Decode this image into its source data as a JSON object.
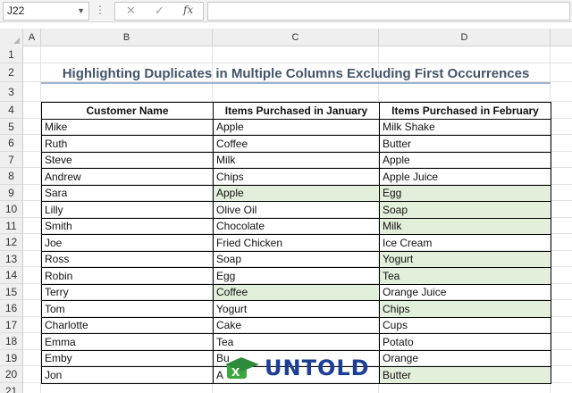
{
  "formula_bar": {
    "name_box": "J22",
    "cancel_icon": "✕",
    "enter_icon": "✓",
    "fx_label": "fx",
    "formula": ""
  },
  "columns": [
    "A",
    "B",
    "C",
    "D"
  ],
  "rows": [
    "1",
    "2",
    "3",
    "4",
    "5",
    "6",
    "7",
    "8",
    "9",
    "10",
    "11",
    "12",
    "13",
    "14",
    "15",
    "16",
    "17",
    "18",
    "19",
    "20",
    "21"
  ],
  "title": "Highlighting Duplicates in Multiple Columns Excluding First Occurrences",
  "table": {
    "headers": [
      "Customer Name",
      "Items Purchased in January",
      "Items Purchased in February"
    ],
    "rows": [
      {
        "name": "Mike",
        "jan": "Apple",
        "feb": "Milk Shake",
        "jan_hl": false,
        "feb_hl": false
      },
      {
        "name": "Ruth",
        "jan": "Coffee",
        "feb": "Butter",
        "jan_hl": false,
        "feb_hl": false
      },
      {
        "name": "Steve",
        "jan": "Milk",
        "feb": "Apple",
        "jan_hl": false,
        "feb_hl": false
      },
      {
        "name": "Andrew",
        "jan": "Chips",
        "feb": "Apple Juice",
        "jan_hl": false,
        "feb_hl": false
      },
      {
        "name": "Sara",
        "jan": "Apple",
        "feb": "Egg",
        "jan_hl": true,
        "feb_hl": true
      },
      {
        "name": " Lilly",
        "jan": "Olive Oil",
        "feb": "Soap",
        "jan_hl": false,
        "feb_hl": true
      },
      {
        "name": "Smith",
        "jan": "Chocolate",
        "feb": "Milk",
        "jan_hl": false,
        "feb_hl": true
      },
      {
        "name": "Joe",
        "jan": "Fried Chicken",
        "feb": "Ice Cream",
        "jan_hl": false,
        "feb_hl": false
      },
      {
        "name": "Ross",
        "jan": "Soap",
        "feb": "Yogurt",
        "jan_hl": false,
        "feb_hl": true
      },
      {
        "name": "Robin",
        "jan": "Egg",
        "feb": "Tea",
        "jan_hl": false,
        "feb_hl": true
      },
      {
        "name": "Terry",
        "jan": "Coffee",
        "feb": "Orange Juice",
        "jan_hl": true,
        "feb_hl": false
      },
      {
        "name": "Tom",
        "jan": "Yogurt",
        "feb": "Chips",
        "jan_hl": false,
        "feb_hl": true
      },
      {
        "name": "Charlotte",
        "jan": "Cake",
        "feb": "Cups",
        "jan_hl": false,
        "feb_hl": false
      },
      {
        "name": "Emma",
        "jan": "Tea",
        "feb": "Potato",
        "jan_hl": false,
        "feb_hl": false
      },
      {
        "name": "Emby",
        "jan": "Bu",
        "feb": "Orange",
        "jan_hl": false,
        "feb_hl": false
      },
      {
        "name": "Jon",
        "jan": "A",
        "feb": "Butter",
        "jan_hl": false,
        "feb_hl": true
      }
    ]
  },
  "watermark": {
    "text": "UNTOLD"
  },
  "colors": {
    "highlight": "#e2efda",
    "title": "#44546a",
    "title_underline": "#9fb2cf",
    "logo": "#1c3f95",
    "logo_accent": "#3ca73c"
  }
}
